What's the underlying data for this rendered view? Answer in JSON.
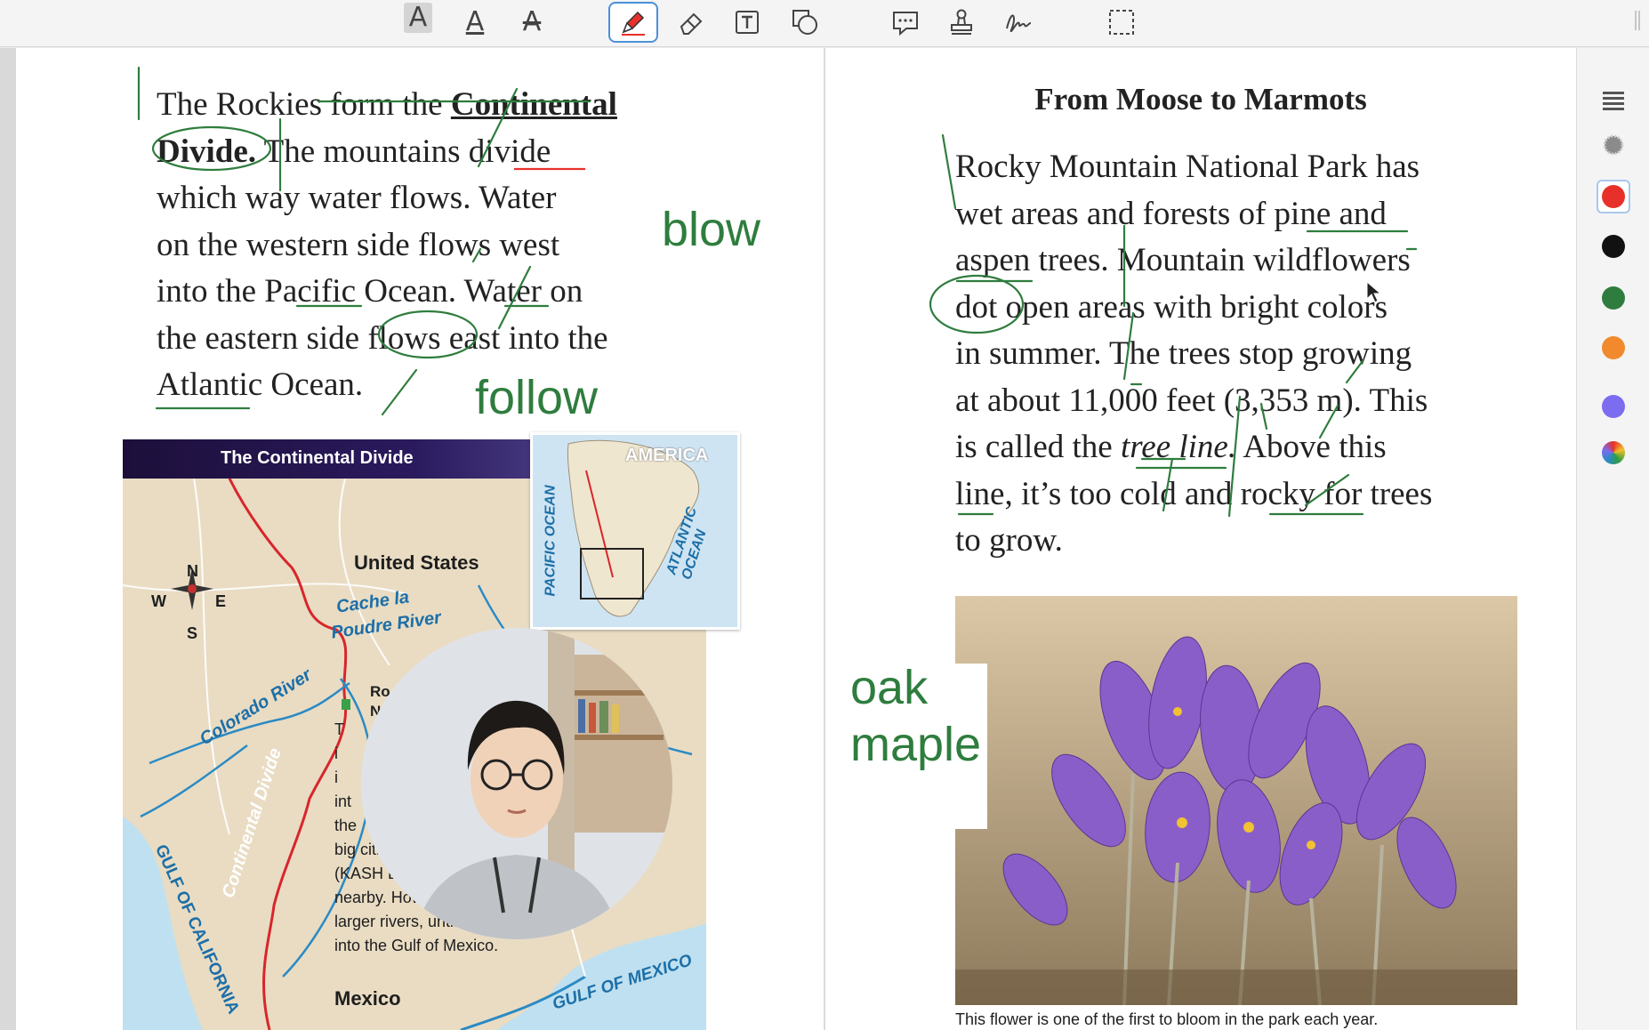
{
  "toolbar": {
    "tools": [
      {
        "name": "text-highlight",
        "glyph": "A"
      },
      {
        "name": "text-underline",
        "glyph": "A"
      },
      {
        "name": "text-strikethrough",
        "glyph": "A"
      },
      {
        "name": "pen",
        "active": true
      },
      {
        "name": "eraser"
      },
      {
        "name": "text-box"
      },
      {
        "name": "shapes"
      },
      {
        "name": "comment"
      },
      {
        "name": "stamp"
      },
      {
        "name": "signature"
      },
      {
        "name": "selection"
      }
    ]
  },
  "left_page": {
    "lines": [
      "The Rockies form the ",
      "Continental",
      "Divide.",
      " The mountains divide",
      "which way water flows. Water",
      "on the western side flows west",
      "into the Pacific Ocean. Water on",
      "the eastern side flows east into the",
      "Atlantic Ocean."
    ],
    "handwriting": [
      "blow",
      "follow"
    ],
    "map": {
      "title": "The Continental Divide",
      "compass": {
        "n": "N",
        "s": "S",
        "e": "E",
        "w": "W"
      },
      "country_top": "United States",
      "country_bottom": "Mexico",
      "rivers": [
        "Cache la",
        "Poudre River",
        "Colorado River",
        "Continental Divide"
      ],
      "waters": [
        "GULF OF CALIFORNIA",
        "GULF OF MEXICO"
      ],
      "partial_label": [
        "Ro",
        "N"
      ],
      "body_text": [
        "T",
        "i",
        "i",
        "int",
        "the",
        "big citi",
        "(KASH LU",
        "nearby. However, it flows east, joining",
        "larger rivers, until the water flows",
        "into the Gulf of Mexico."
      ],
      "inset": {
        "title": "AMERICA",
        "left": "PACIFIC OCEAN",
        "right": "ATLANTIC OCEAN"
      }
    }
  },
  "right_page": {
    "title": "From Moose to Marmots",
    "lines": [
      "Rocky Mountain National Park has",
      "wet areas and forests of pine and",
      "aspen trees. Mountain wildflowers",
      "dot open areas with bright colors",
      "in summer. The trees stop growing",
      "at about 11,000 feet (3,353 m). This",
      "is called the ",
      "tree line.",
      " Above this",
      "line, it’s too cold and rocky for trees",
      "to grow."
    ],
    "handwriting": [
      "oak",
      "maple"
    ],
    "caption": "This flower is one of the first to bloom in the park each year."
  },
  "right_rail": {
    "colors": [
      "#e8302a",
      "#111111",
      "#2f7d3e",
      "#f08a2c",
      "#7b6cf0"
    ],
    "selected_color": "#e8302a"
  }
}
